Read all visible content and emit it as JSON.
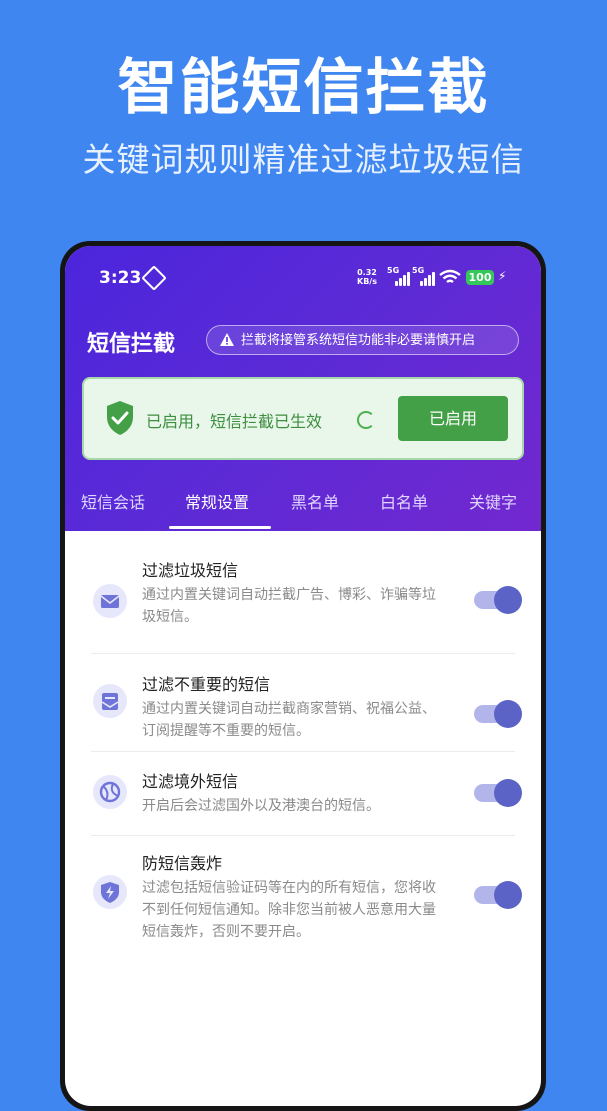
{
  "promo": {
    "title": "智能短信拦截",
    "subtitle": "关键词规则精准过滤垃圾短信"
  },
  "status_bar": {
    "time": "3:23",
    "net_speed_value": "0.32",
    "net_speed_unit": "KB/s",
    "signal1_label": "5G",
    "signal2_label": "5G",
    "battery": "100"
  },
  "header": {
    "title": "短信拦截",
    "warning": "拦截将接管系统短信功能非必要请慎开启"
  },
  "status_card": {
    "text": "已启用，短信拦截已生效",
    "button_label": "已启用"
  },
  "tabs": [
    {
      "label": "短信会话",
      "active": false
    },
    {
      "label": "常规设置",
      "active": true
    },
    {
      "label": "黑名单",
      "active": false
    },
    {
      "label": "白名单",
      "active": false
    },
    {
      "label": "关键字",
      "active": false
    }
  ],
  "settings": [
    {
      "title": "过滤垃圾短信",
      "desc": "通过内置关键词自动拦截广告、博彩、诈骗等垃圾短信。",
      "icon": "mail-icon",
      "enabled": true
    },
    {
      "title": "过滤不重要的短信",
      "desc": "通过内置关键词自动拦截商家营销、祝福公益、订阅提醒等不重要的短信。",
      "icon": "mailbox-icon",
      "enabled": true
    },
    {
      "title": "过滤境外短信",
      "desc": "开启后会过滤国外以及港澳台的短信。",
      "icon": "globe-icon",
      "enabled": true
    },
    {
      "title": "防短信轰炸",
      "desc": "过滤包括短信验证码等在内的所有短信，您将收不到任何短信通知。除非您当前被人恶意用大量短信轰炸，否则不要开启。",
      "icon": "lightning-shield-icon",
      "enabled": true
    }
  ],
  "colors": {
    "background": "#3f86f1",
    "header_start": "#4c25dd",
    "header_end": "#7328cf",
    "success": "#43a047",
    "toggle_knob": "#5b63c7"
  }
}
